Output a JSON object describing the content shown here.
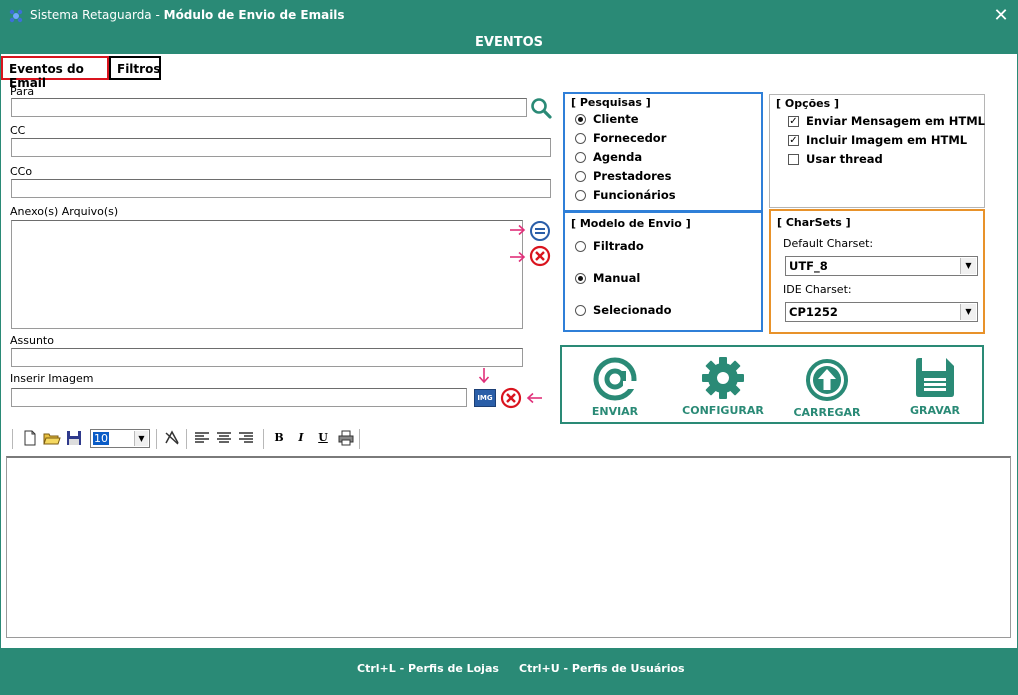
{
  "window": {
    "app_name": "Sistema Retaguarda - ",
    "module_name": "Módulo de Envio de Emails",
    "close_glyph": "✕"
  },
  "header": {
    "title": "EVENTOS"
  },
  "tabs": [
    {
      "label": "Eventos do Email",
      "active": true
    },
    {
      "label": "Filtros",
      "active": false
    }
  ],
  "form": {
    "para_label": "Para",
    "para_value": "",
    "cc_label": "CC",
    "cc_value": "",
    "cco_label": "CCo",
    "cco_value": "",
    "anexo_label": "Anexo(s) Arquivo(s)",
    "assunto_label": "Assunto",
    "assunto_value": "",
    "imagem_label": "Inserir Imagem",
    "imagem_value": ""
  },
  "pesquisas": {
    "title": "[ Pesquisas ]",
    "options": [
      "Cliente",
      "Fornecedor",
      "Agenda",
      "Prestadores",
      "Funcionários"
    ],
    "selected": "Cliente"
  },
  "modelo": {
    "title": "[ Modelo de Envio ]",
    "options": [
      "Filtrado",
      "Manual",
      "Selecionado"
    ],
    "selected": "Manual"
  },
  "opcoes": {
    "title": "[ Opções ]",
    "items": [
      {
        "label": "Enviar Mensagem em HTML",
        "checked": true
      },
      {
        "label": "Incluir Imagem em HTML",
        "checked": true
      },
      {
        "label": "Usar thread",
        "checked": false
      }
    ]
  },
  "charsets": {
    "title": "[ CharSets ]",
    "default_label": "Default Charset:",
    "default_value": "UTF_8",
    "ide_label": "IDE Charset:",
    "ide_value": "CP1252"
  },
  "actions": {
    "enviar": "ENVIAR",
    "configurar": "CONFIGURAR",
    "carregar": "CARREGAR",
    "gravar": "GRAVAR"
  },
  "toolbar": {
    "font_size": "10",
    "bold": "B",
    "italic": "I",
    "underline": "U",
    "img_badge": "IMG"
  },
  "footer": {
    "shortcut_lojas": "Ctrl+L - Perfis de Lojas",
    "shortcut_usuarios": "Ctrl+U - Perfis de Usuários"
  },
  "colors": {
    "brand": "#2a8a76",
    "pesquisas_border": "#2f7fd8",
    "charsets_border": "#e8922a",
    "danger": "#d9141e",
    "arrow": "#e0307a"
  }
}
